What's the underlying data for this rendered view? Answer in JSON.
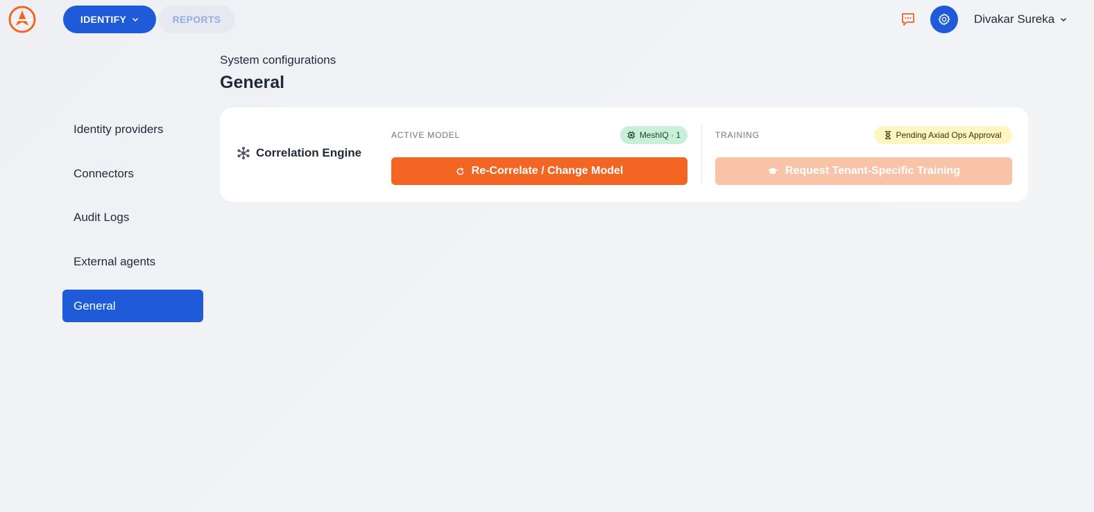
{
  "header": {
    "logo_icon": "axiad-logo-icon",
    "nav": [
      {
        "label": "IDENTIFY",
        "active": true
      },
      {
        "label": "REPORTS",
        "active": false
      }
    ],
    "user_name": "Divakar Sureka"
  },
  "sidebar": {
    "items": [
      {
        "label": "Identity providers",
        "active": false
      },
      {
        "label": "Connectors",
        "active": false
      },
      {
        "label": "Audit Logs",
        "active": false
      },
      {
        "label": "External agents",
        "active": false
      },
      {
        "label": "General",
        "active": true
      }
    ]
  },
  "page": {
    "breadcrumb": "System configurations",
    "title": "General"
  },
  "card": {
    "engine_label": "Correlation Engine",
    "active_model_label": "ACTIVE MODEL",
    "active_model_badge": "MeshIQ · 1",
    "training_label": "TRAINING",
    "training_badge": "Pending Axiad Ops Approval",
    "recorrelate_button": "Re-Correlate / Change Model",
    "request_training_button": "Request Tenant-Specific Training"
  },
  "colors": {
    "primary_blue": "#1f5bd8",
    "accent_orange": "#f26522",
    "disabled_orange": "#f9c3a7",
    "badge_green": "#c8f0d8",
    "badge_yellow": "#fdf6c3"
  }
}
